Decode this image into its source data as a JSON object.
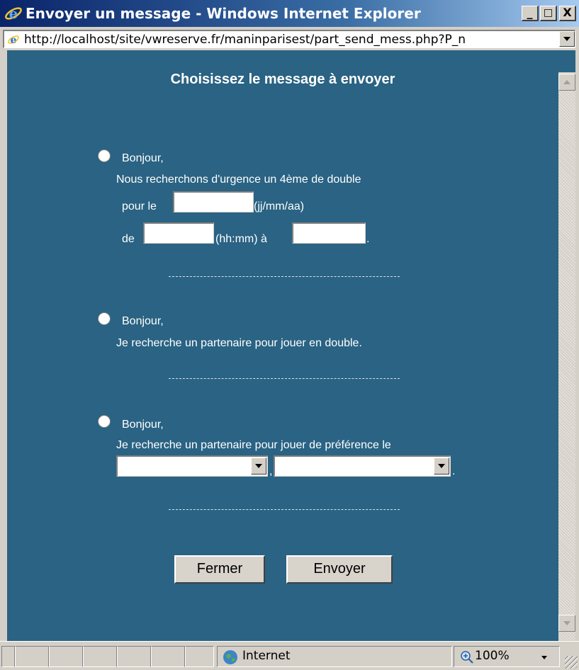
{
  "window": {
    "title": "Envoyer un message - Windows Internet Explorer",
    "controls": {
      "minimize": "_",
      "maximize": "□",
      "close": "X"
    }
  },
  "address_bar": {
    "url": "http://localhost/site/vwreserve.fr/maninparisest/part_send_mess.php?P_n"
  },
  "page": {
    "heading": "Choisissez le message à envoyer",
    "option1": {
      "greeting": "Bonjour,",
      "line1": "Nous recherchons d'urgence un 4ème de double",
      "date_prefix": "pour le",
      "date_value": "",
      "date_hint": "(jj/mm/aa)",
      "from_prefix": "de",
      "from_value": "",
      "time_hint": "(hh:mm) à",
      "to_value": "",
      "end_dot": "."
    },
    "separator": "-------------------------------------------------------------",
    "option2": {
      "greeting": "Bonjour,",
      "line1": "Je recherche un partenaire pour jouer en double."
    },
    "option3": {
      "greeting": "Bonjour,",
      "line1": "Je recherche un partenaire pour jouer de préférence le",
      "select1_value": "",
      "comma": ",",
      "select2_value": "",
      "end_dot": "."
    },
    "buttons": {
      "close": "Fermer",
      "send": "Envoyer"
    }
  },
  "status_bar": {
    "zone": "Internet",
    "zoom": "100%"
  }
}
